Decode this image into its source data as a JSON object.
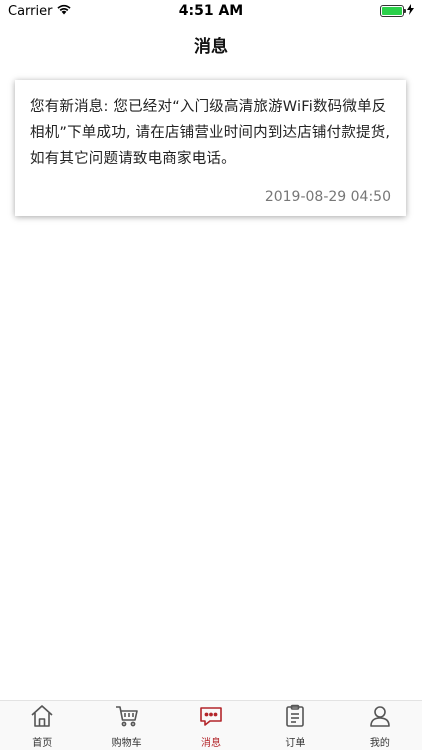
{
  "status_bar": {
    "carrier": "Carrier",
    "time": "4:51 AM"
  },
  "nav": {
    "title": "消息"
  },
  "messages": [
    {
      "text": "您有新消息: 您已经对“入门级高清旅游WiFi数码微单反相机”下单成功, 请在店铺营业时间内到达店铺付款提货, 如有其它问题请致电商家电话。",
      "time": "2019-08-29 04:50"
    }
  ],
  "tabs": [
    {
      "label": "首页",
      "icon": "home-icon"
    },
    {
      "label": "购物车",
      "icon": "cart-icon"
    },
    {
      "label": "消息",
      "icon": "message-icon",
      "active": true
    },
    {
      "label": "订单",
      "icon": "order-icon"
    },
    {
      "label": "我的",
      "icon": "profile-icon"
    }
  ],
  "colors": {
    "accent": "#b3262b",
    "battery": "#2bd04a"
  }
}
